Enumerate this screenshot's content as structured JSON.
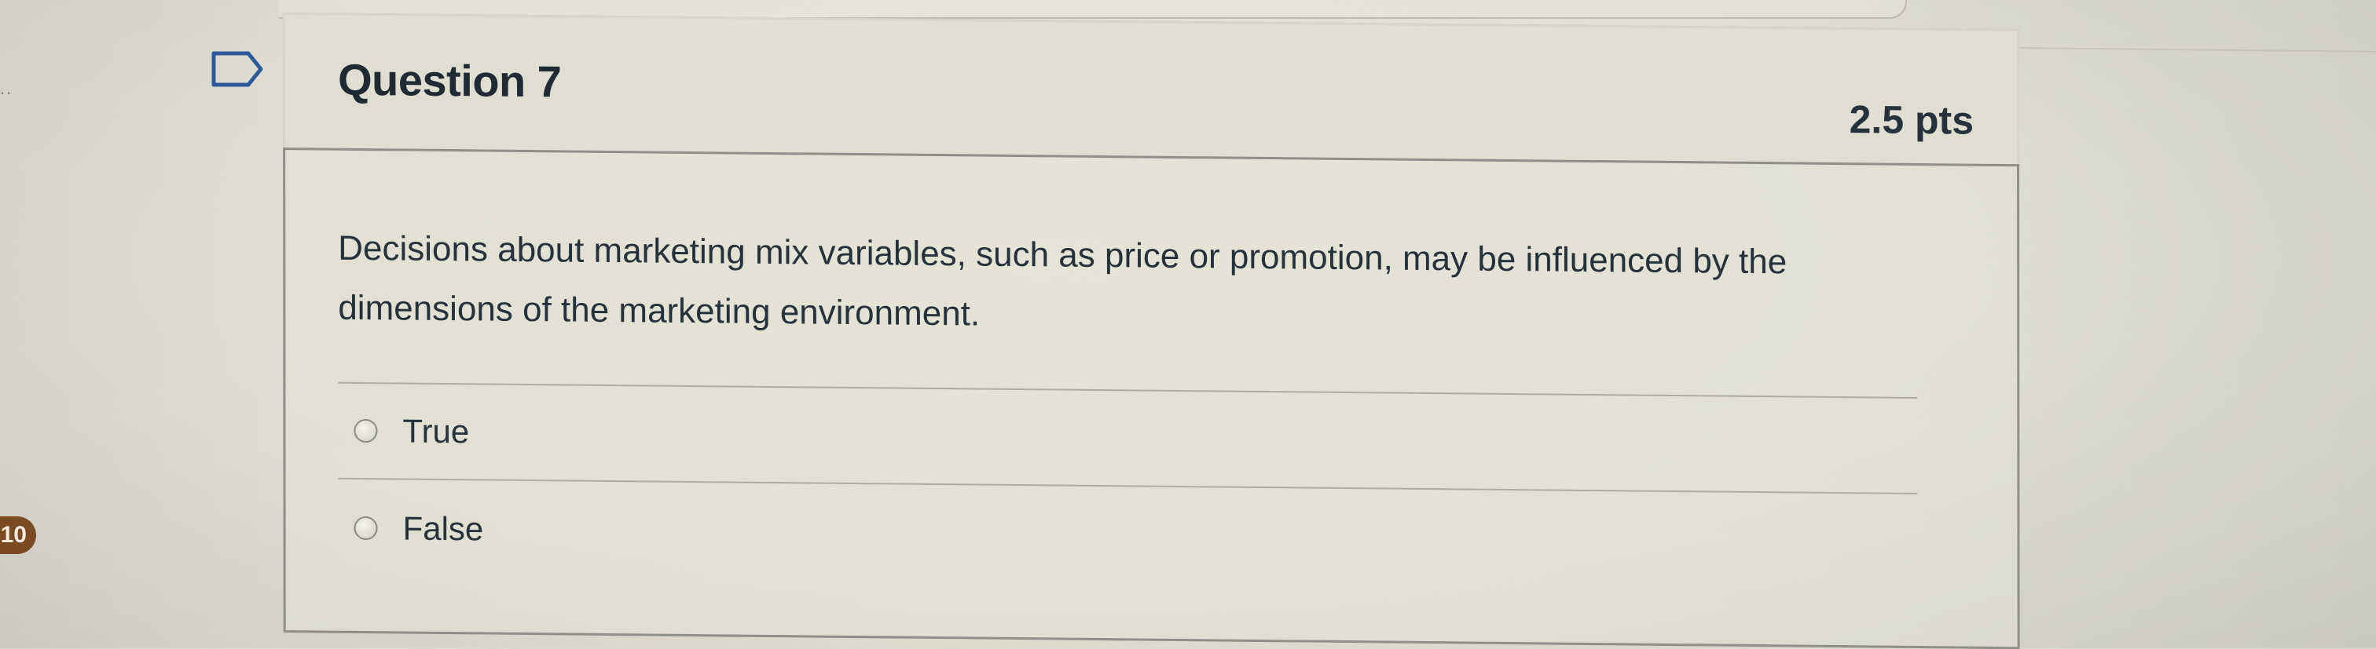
{
  "page": {
    "left_indicator": "..",
    "page_number_badge": "10"
  },
  "question": {
    "title": "Question 7",
    "points": "2.5 pts",
    "text": "Decisions about marketing mix variables, such as price or promotion, may be influenced by the dimensions of the marketing environment.",
    "flagged": false
  },
  "answers": [
    {
      "label": "True",
      "selected": false
    },
    {
      "label": "False",
      "selected": false
    }
  ],
  "icons": {
    "flag": "bookmark-flag-icon",
    "radio": "radio-button-icon"
  },
  "colors": {
    "badge_bg": "#7a4a22",
    "text": "#26323b",
    "border": "#8f8f8a"
  }
}
